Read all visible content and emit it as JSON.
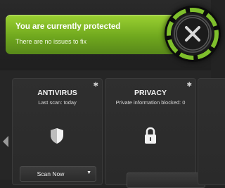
{
  "status": {
    "title": "You are currently protected",
    "subtitle": "There are no issues to fix"
  },
  "badge": {
    "icon": "tools-icon"
  },
  "tiles": [
    {
      "title": "ANTIVIRUS",
      "subtitle": "Last scan: today",
      "icon": "shield-icon",
      "settings_icon": "gear-icon",
      "button_label": "Scan Now",
      "button_icon": "chevron-down-icon"
    },
    {
      "title": "PRIVACY",
      "subtitle": "Private information blocked: 0",
      "icon": "lock-icon",
      "settings_icon": "gear-icon"
    }
  ],
  "nav": {
    "left_icon": "arrow-left-icon"
  },
  "colors": {
    "accent_green": "#8cc63f",
    "banner_dark_green": "#58881a",
    "background": "#232323",
    "tile": "#2f2f2f"
  }
}
